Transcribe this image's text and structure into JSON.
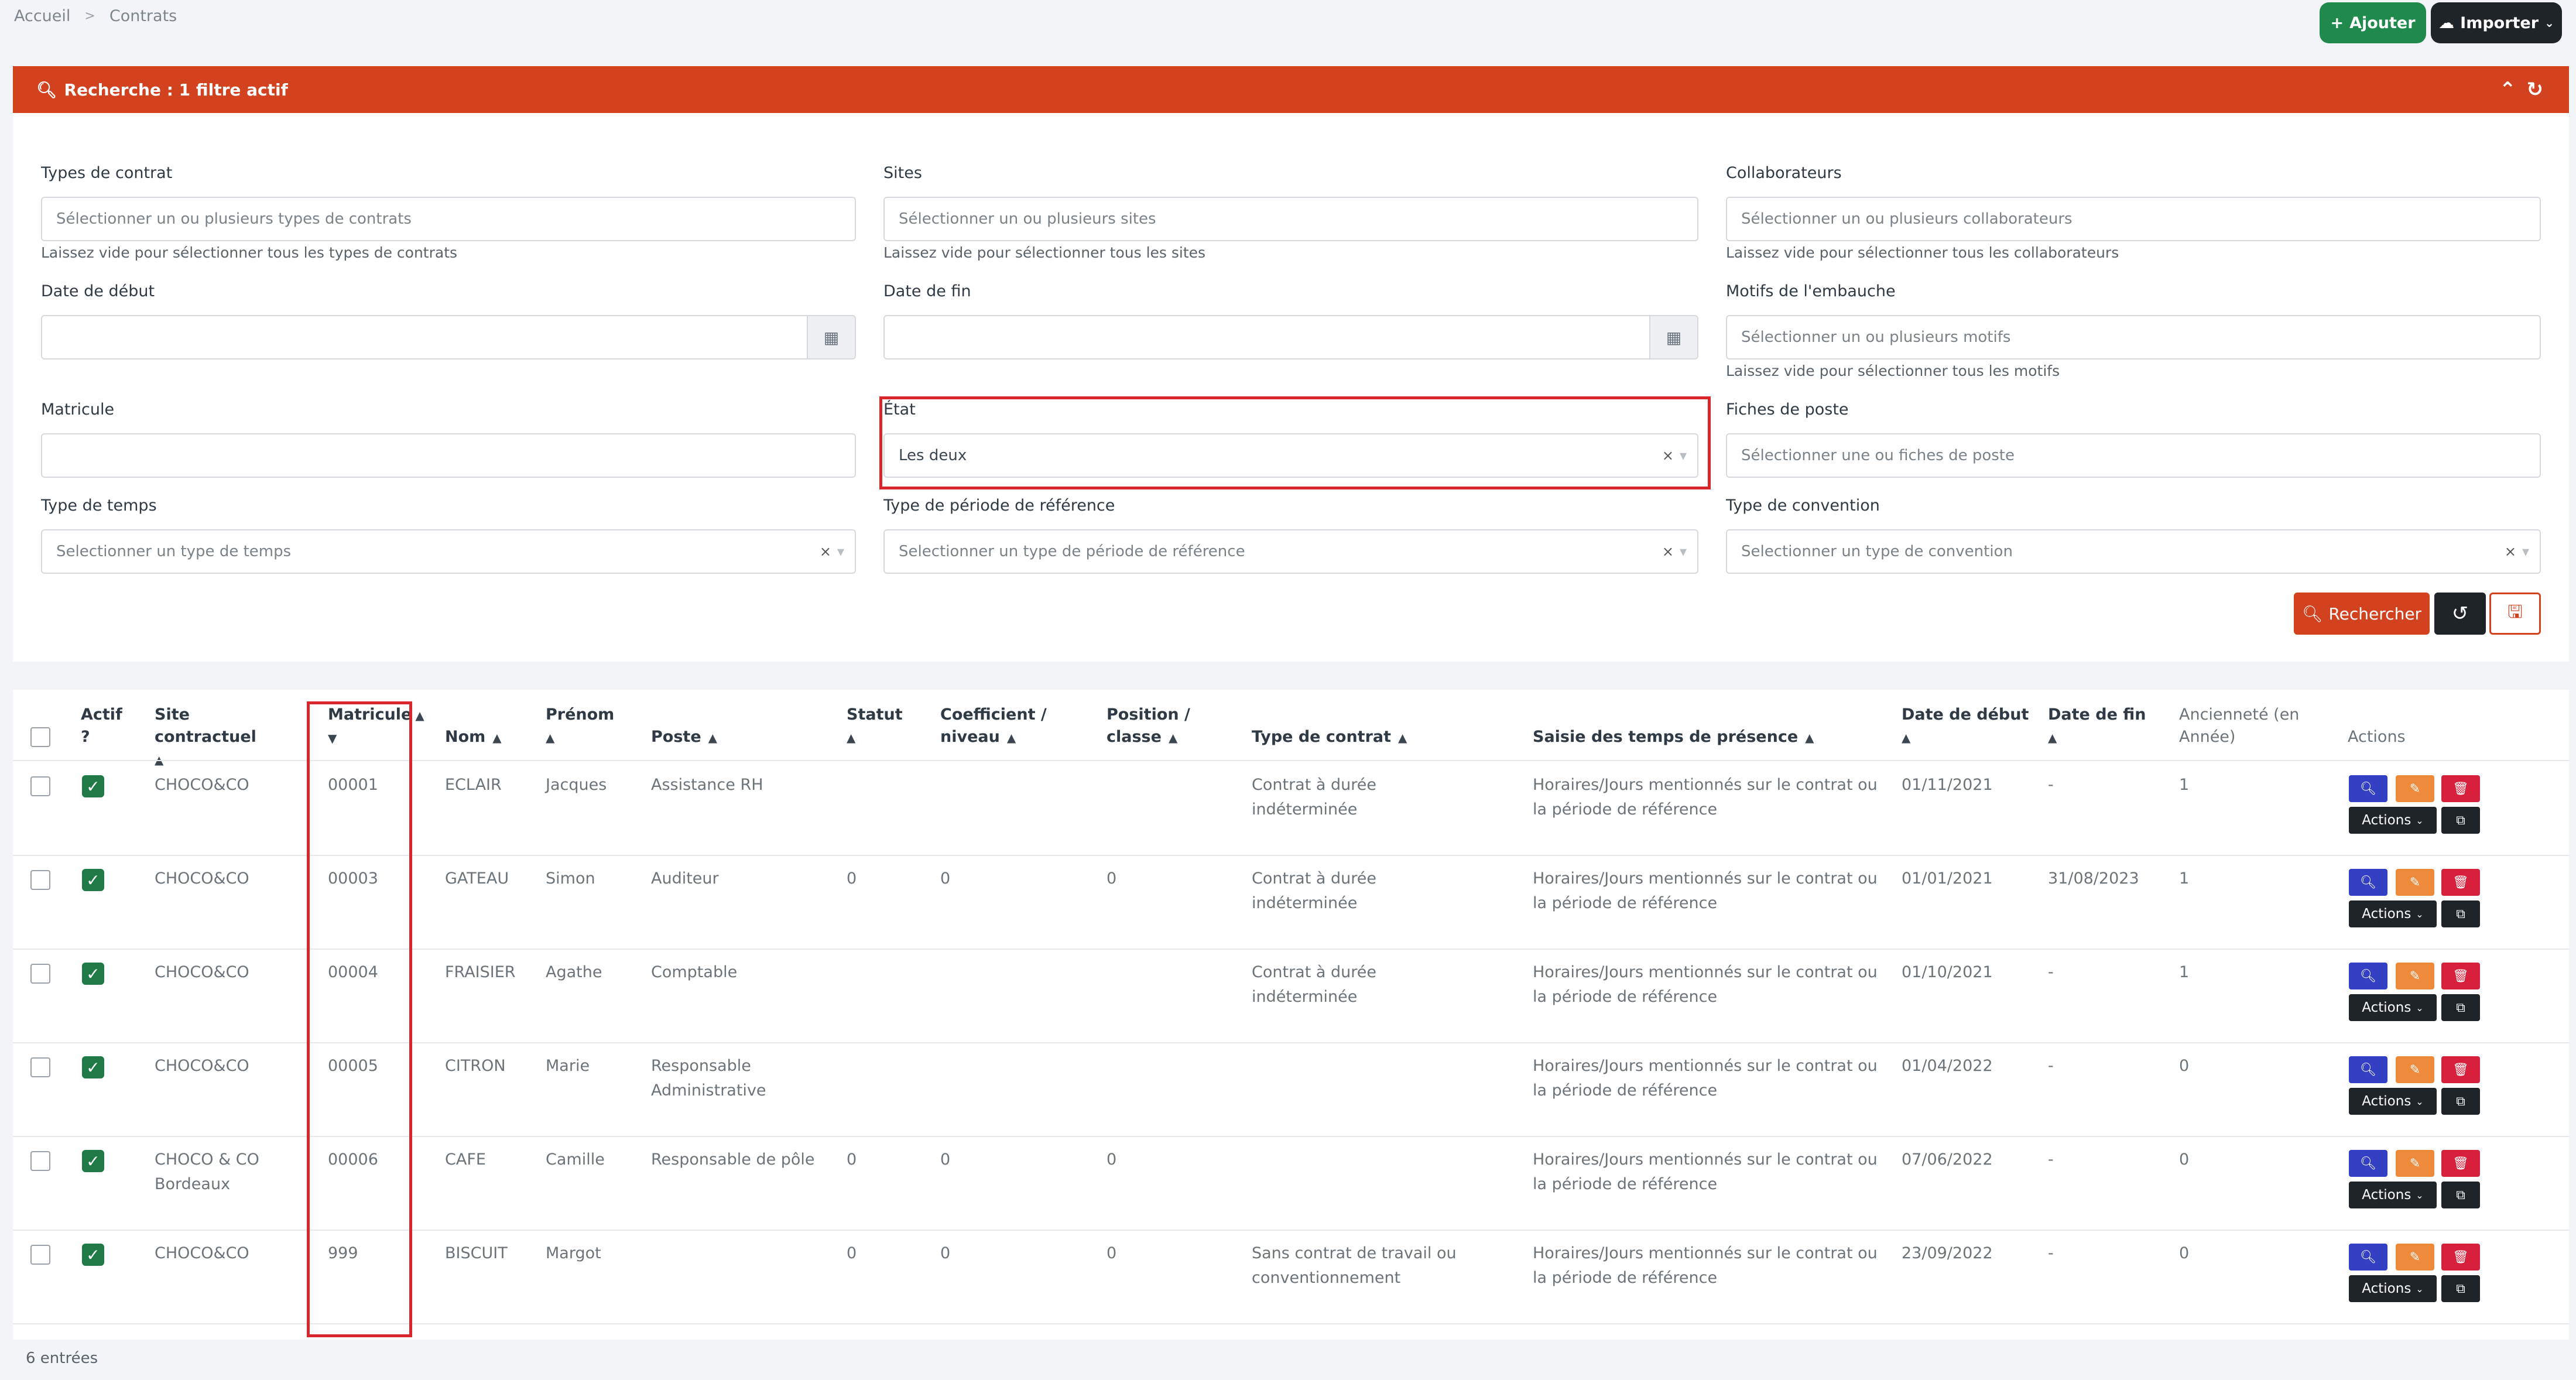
{
  "breadcrumb": {
    "home": "Accueil",
    "current": "Contrats"
  },
  "top_buttons": {
    "add": "Ajouter",
    "import": "Importer"
  },
  "search": {
    "title": "Recherche : 1 filtre actif",
    "fields": {
      "types_contrat": {
        "label": "Types de contrat",
        "placeholder": "Sélectionner un ou plusieurs types de contrats",
        "help": "Laissez vide pour sélectionner tous les types de contrats"
      },
      "sites": {
        "label": "Sites",
        "placeholder": "Sélectionner un ou plusieurs sites",
        "help": "Laissez vide pour sélectionner tous les sites"
      },
      "collaborateurs": {
        "label": "Collaborateurs",
        "placeholder": "Sélectionner un ou plusieurs collaborateurs",
        "help": "Laissez vide pour sélectionner tous les collaborateurs"
      },
      "date_debut": {
        "label": "Date de début"
      },
      "date_fin": {
        "label": "Date de fin"
      },
      "motifs": {
        "label": "Motifs de l'embauche",
        "placeholder": "Sélectionner un ou plusieurs motifs",
        "help": "Laissez vide pour sélectionner tous les motifs"
      },
      "matricule": {
        "label": "Matricule"
      },
      "etat": {
        "label": "État",
        "value": "Les deux"
      },
      "fiches": {
        "label": "Fiches de poste",
        "placeholder": "Sélectionner une ou fiches de poste"
      },
      "type_temps": {
        "label": "Type de temps",
        "placeholder": "Selectionner un type de temps"
      },
      "type_periode": {
        "label": "Type de période de référence",
        "placeholder": "Selectionner un type de période de référence"
      },
      "type_convention": {
        "label": "Type de convention",
        "placeholder": "Selectionner un type de convention"
      }
    },
    "buttons": {
      "search": "Rechercher"
    }
  },
  "table": {
    "headers": {
      "actif": "Actif ?",
      "site": "Site contractuel",
      "matricule": "Matricule",
      "nom": "Nom",
      "prenom": "Prénom",
      "poste": "Poste",
      "statut": "Statut",
      "coef": "Coefficient / niveau",
      "position": "Position / classe",
      "type_contrat": "Type de contrat",
      "saisie": "Saisie des temps de présence",
      "date_debut": "Date de début",
      "date_fin": "Date de fin",
      "anciennete": "Ancienneté (en Année)",
      "actions": "Actions"
    },
    "rows": [
      {
        "site": "CHOCO&CO",
        "matricule": "00001",
        "nom": "ECLAIR",
        "prenom": "Jacques",
        "poste": "Assistance RH",
        "statut": "",
        "coef": "",
        "position": "",
        "type_contrat": "Contrat à durée indéterminée",
        "saisie": "Horaires/Jours mentionnés sur le contrat ou la période de référence",
        "date_debut": "01/11/2021",
        "date_fin": "-",
        "anciennete": "1"
      },
      {
        "site": "CHOCO&CO",
        "matricule": "00003",
        "nom": "GATEAU",
        "prenom": "Simon",
        "poste": "Auditeur",
        "statut": "0",
        "coef": "0",
        "position": "0",
        "type_contrat": "Contrat à durée indéterminée",
        "saisie": "Horaires/Jours mentionnés sur le contrat ou la période de référence",
        "date_debut": "01/01/2021",
        "date_fin": "31/08/2023",
        "anciennete": "1"
      },
      {
        "site": "CHOCO&CO",
        "matricule": "00004",
        "nom": "FRAISIER",
        "prenom": "Agathe",
        "poste": "Comptable",
        "statut": "",
        "coef": "",
        "position": "",
        "type_contrat": "Contrat à durée indéterminée",
        "saisie": "Horaires/Jours mentionnés sur le contrat ou la période de référence",
        "date_debut": "01/10/2021",
        "date_fin": "-",
        "anciennete": "1"
      },
      {
        "site": "CHOCO&CO",
        "matricule": "00005",
        "nom": "CITRON",
        "prenom": "Marie",
        "poste": "Responsable Administrative",
        "statut": "",
        "coef": "",
        "position": "",
        "type_contrat": "",
        "saisie": "Horaires/Jours mentionnés sur le contrat ou la période de référence",
        "date_debut": "01/04/2022",
        "date_fin": "-",
        "anciennete": "0"
      },
      {
        "site": "CHOCO & CO Bordeaux",
        "matricule": "00006",
        "nom": "CAFE",
        "prenom": "Camille",
        "poste": "Responsable de pôle",
        "statut": "0",
        "coef": "0",
        "position": "0",
        "type_contrat": "",
        "saisie": "Horaires/Jours mentionnés sur le contrat ou la période de référence",
        "date_debut": "07/06/2022",
        "date_fin": "-",
        "anciennete": "0"
      },
      {
        "site": "CHOCO&CO",
        "matricule": "999",
        "nom": "BISCUIT",
        "prenom": "Margot",
        "poste": "",
        "statut": "0",
        "coef": "0",
        "position": "0",
        "type_contrat": "Sans contrat de travail ou conventionnement",
        "saisie": "Horaires/Jours mentionnés sur le contrat ou la période de référence",
        "date_debut": "23/09/2022",
        "date_fin": "-",
        "anciennete": "0"
      }
    ],
    "actions_label": "Actions",
    "footer": "6 entrées"
  },
  "colors": {
    "accent": "#d3421f",
    "success": "#1f8a4c",
    "dark": "#1f2428",
    "highlight": "#d8262a"
  }
}
